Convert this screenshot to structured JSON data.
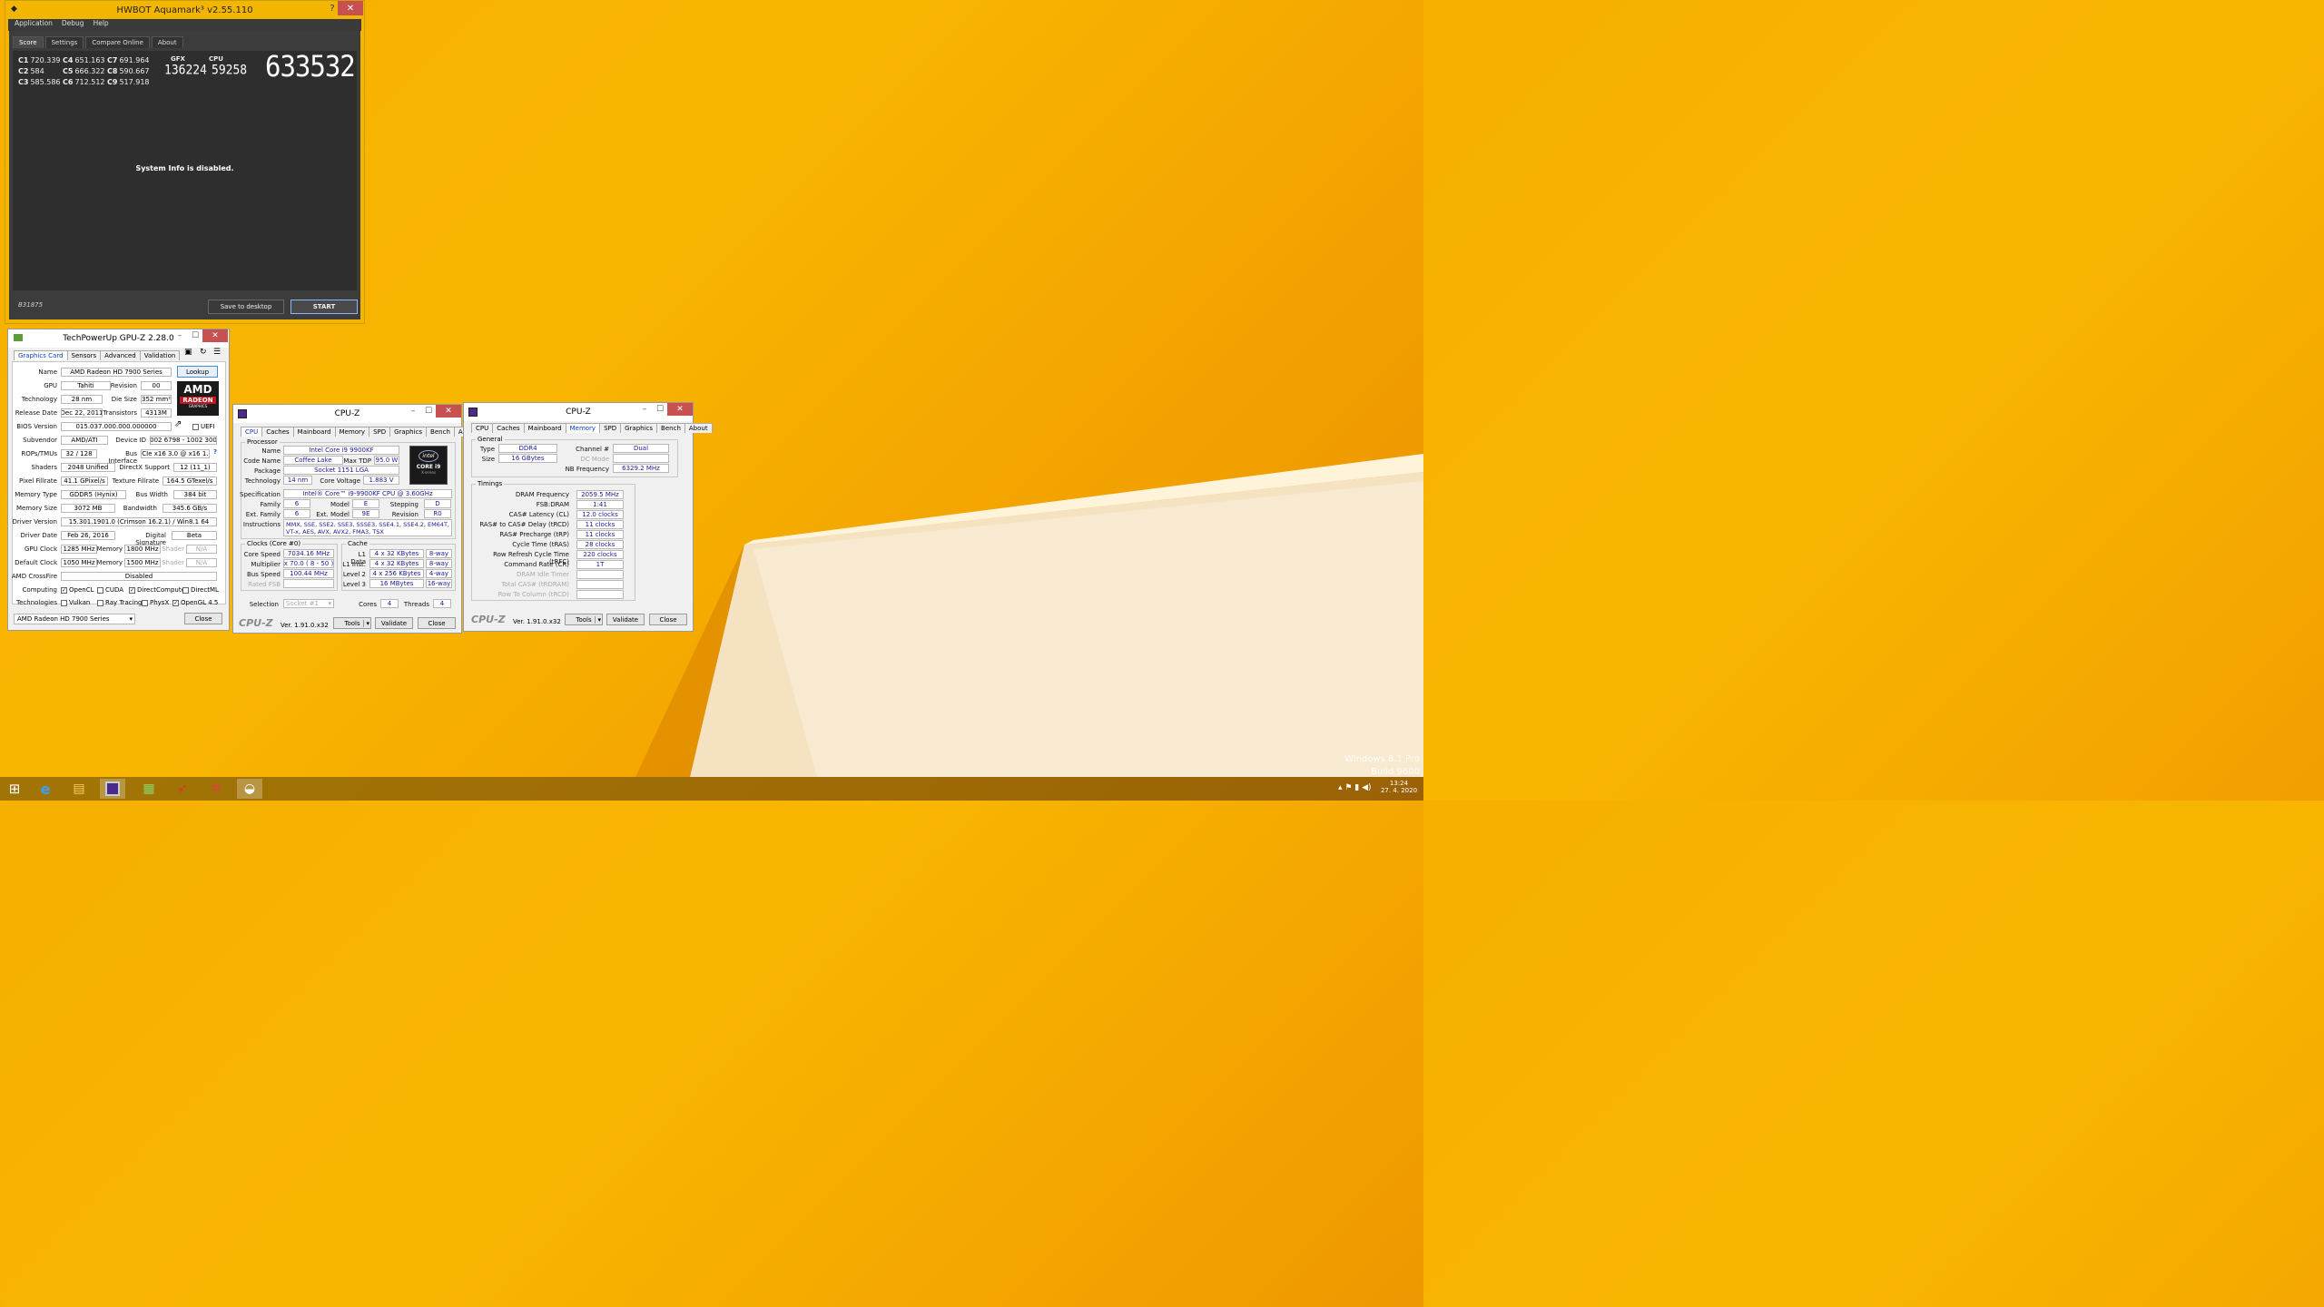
{
  "aquamark": {
    "title": "HWBOT Aquamark³ v2.55.110",
    "menu": [
      "Application",
      "Debug",
      "Help"
    ],
    "tabs": [
      "Score",
      "Settings",
      "Compare Online",
      "About"
    ],
    "scores": [
      {
        "k": "C1",
        "v": "720.339"
      },
      {
        "k": "C4",
        "v": "651.163"
      },
      {
        "k": "C7",
        "v": "691.964"
      },
      {
        "k": "C2",
        "v": "584"
      },
      {
        "k": "C5",
        "v": "666.322"
      },
      {
        "k": "C8",
        "v": "590.667"
      },
      {
        "k": "C3",
        "v": "585.586"
      },
      {
        "k": "C6",
        "v": "712.512"
      },
      {
        "k": "C9",
        "v": "517.918"
      }
    ],
    "gfx_label": "GFX",
    "gfx": "136224",
    "cpu_label": "CPU",
    "cpu": "59258",
    "total": "633532",
    "message": "System Info is disabled.",
    "build": "B31875",
    "save_label": "Save to desktop",
    "start_label": "START",
    "help": "?",
    "close": "✕"
  },
  "gpuz": {
    "title": "TechPowerUp GPU-Z 2.28.0",
    "tabs": [
      "Graphics Card",
      "Sensors",
      "Advanced",
      "Validation"
    ],
    "lookup": "Lookup",
    "labels": {
      "name": "Name",
      "gpu": "GPU",
      "revision": "Revision",
      "technology": "Technology",
      "die_size": "Die Size",
      "release": "Release Date",
      "transistors": "Transistors",
      "bios": "BIOS Version",
      "uefi": "UEFI",
      "subvendor": "Subvendor",
      "device_id": "Device ID",
      "rops": "ROPs/TMUs",
      "bus_interface": "Bus Interface",
      "shaders": "Shaders",
      "directx": "DirectX Support",
      "pixel": "Pixel Fillrate",
      "texture": "Texture Fillrate",
      "mem_type": "Memory Type",
      "bus_width": "Bus Width",
      "mem_size": "Memory Size",
      "bandwidth": "Bandwidth",
      "driver_ver": "Driver Version",
      "driver_date": "Driver Date",
      "dig_sig": "Digital Signature",
      "gpu_clock": "GPU Clock",
      "memory": "Memory",
      "shader": "Shader",
      "default_clock": "Default Clock",
      "crossfire": "AMD CrossFire",
      "computing": "Computing",
      "technologies": "Technologies"
    },
    "values": {
      "name": "AMD Radeon HD 7900 Series",
      "gpu": "Tahiti",
      "revision": "00",
      "technology": "28 nm",
      "die_size": "352 mm²",
      "release": "Dec 22, 2011",
      "transistors": "4313M",
      "bios": "015.037.000.000.000000",
      "subvendor": "AMD/ATI",
      "device_id": "1002 6798 - 1002 3000",
      "rops": "32 / 128",
      "bus_interface": "PCIe x16 3.0 @ x16 1.1",
      "shaders": "2048 Unified",
      "directx": "12 (11_1)",
      "pixel": "41.1 GPixel/s",
      "texture": "164.5 GTexel/s",
      "mem_type": "GDDR5 (Hynix)",
      "bus_width": "384 bit",
      "mem_size": "3072 MB",
      "bandwidth": "345.6 GB/s",
      "driver_ver": "15.301.1901.0 (Crimson 16.2.1) / Win8.1 64",
      "driver_date": "Feb 26, 2016",
      "dig_sig": "Beta",
      "gpu_clock": "1285 MHz",
      "gpu_mem": "1800 MHz",
      "shader_na": "N/A",
      "def_clock": "1050 MHz",
      "def_mem": "1500 MHz",
      "crossfire": "Disabled"
    },
    "computing": [
      "OpenCL",
      "CUDA",
      "DirectCompute",
      "DirectML"
    ],
    "technologies": [
      "Vulkan",
      "Ray Tracing",
      "PhysX",
      "OpenGL 4.5"
    ],
    "select": "AMD Radeon HD 7900 Series",
    "close": "Close",
    "logo": "AMD",
    "logo_sub": "RADEON",
    "logo_small": "GRAPHICS",
    "help": "?"
  },
  "cpuz1": {
    "title": "CPU-Z",
    "tabs": [
      "CPU",
      "Caches",
      "Mainboard",
      "Memory",
      "SPD",
      "Graphics",
      "Bench",
      "About"
    ],
    "processor_group": "Processor",
    "labels": {
      "name": "Name",
      "codename": "Code Name",
      "maxtdp": "Max TDP",
      "package": "Package",
      "technology": "Technology",
      "corevoltage": "Core Voltage",
      "spec": "Specification",
      "family": "Family",
      "model": "Model",
      "stepping": "Stepping",
      "extfamily": "Ext. Family",
      "extmodel": "Ext. Model",
      "revision": "Revision",
      "instructions": "Instructions"
    },
    "values": {
      "name": "Intel Core i9 9900KF",
      "codename": "Coffee Lake",
      "maxtdp": "95.0 W",
      "package": "Socket 1151 LGA",
      "technology": "14 nm",
      "corevoltage": "1.883 V",
      "spec": "Intel® Core™ i9-9900KF CPU @ 3.60GHz",
      "family": "6",
      "model": "E",
      "stepping": "D",
      "extfamily": "6",
      "extmodel": "9E",
      "revision": "R0",
      "instructions": "MMX, SSE, SSE2, SSE3, SSSE3, SSE4.1, SSE4.2, EM64T, VT-x, AES, AVX, AVX2, FMA3, TSX"
    },
    "clocks_group": "Clocks (Core #0)",
    "clock_labels": [
      "Core Speed",
      "Multiplier",
      "Bus Speed",
      "Rated FSB"
    ],
    "clock_values": [
      "7034.16 MHz",
      "x 70.0 ( 8 - 50 )",
      "100.44 MHz",
      ""
    ],
    "cache_group": "Cache",
    "cache_labels": [
      "L1 Data",
      "L1 Inst.",
      "Level 2",
      "Level 3"
    ],
    "cache_sizes": [
      "4 x 32 KBytes",
      "4 x 32 KBytes",
      "4 x 256 KBytes",
      "16 MBytes"
    ],
    "cache_ways": [
      "8-way",
      "8-way",
      "4-way",
      "16-way"
    ],
    "selection_label": "Selection",
    "selection": "Socket #1",
    "cores_label": "Cores",
    "cores": "4",
    "threads_label": "Threads",
    "threads": "4",
    "brand": "CPU-Z",
    "version": "Ver. 1.91.0.x32",
    "tools": "Tools",
    "validate": "Validate",
    "close": "Close",
    "badge_top": "intel",
    "badge_mid": "CORE i9",
    "badge_bot": "X-series"
  },
  "cpuz2": {
    "title": "CPU-Z",
    "tabs": [
      "CPU",
      "Caches",
      "Mainboard",
      "Memory",
      "SPD",
      "Graphics",
      "Bench",
      "About"
    ],
    "general_group": "General",
    "type_label": "Type",
    "type": "DDR4",
    "size_label": "Size",
    "size": "16 GBytes",
    "channel_label": "Channel #",
    "channel": "Dual",
    "dc_label": "DC Mode",
    "dc": "",
    "nb_label": "NB Frequency",
    "nb": "6329.2 MHz",
    "timings_group": "Timings",
    "timing_labels": [
      "DRAM Frequency",
      "FSB:DRAM",
      "CAS# Latency (CL)",
      "RAS# to CAS# Delay (tRCD)",
      "RAS# Precharge (tRP)",
      "Cycle Time (tRAS)",
      "Row Refresh Cycle Time (tRFC)",
      "Command Rate (CR)",
      "DRAM Idle Timer",
      "Total CAS# (tRDRAM)",
      "Row To Column (tRCD)"
    ],
    "timing_values": [
      "2059.5 MHz",
      "1:41",
      "12.0 clocks",
      "11 clocks",
      "11 clocks",
      "28 clocks",
      "220 clocks",
      "1T",
      "",
      "",
      ""
    ],
    "brand": "CPU-Z",
    "version": "Ver. 1.91.0.x32",
    "tools": "Tools",
    "validate": "Validate",
    "close": "Close"
  },
  "watermark": {
    "line1": "Windows 8.1 Pro",
    "line2": "Build 9600"
  },
  "clock": {
    "time": "13:24",
    "date": "27. 4. 2020"
  },
  "colors": {
    "desktop": "#f6b000",
    "aqua_frame": "#f2b600",
    "aqua_bg": "#3c3c3c",
    "close": "#c75050"
  }
}
